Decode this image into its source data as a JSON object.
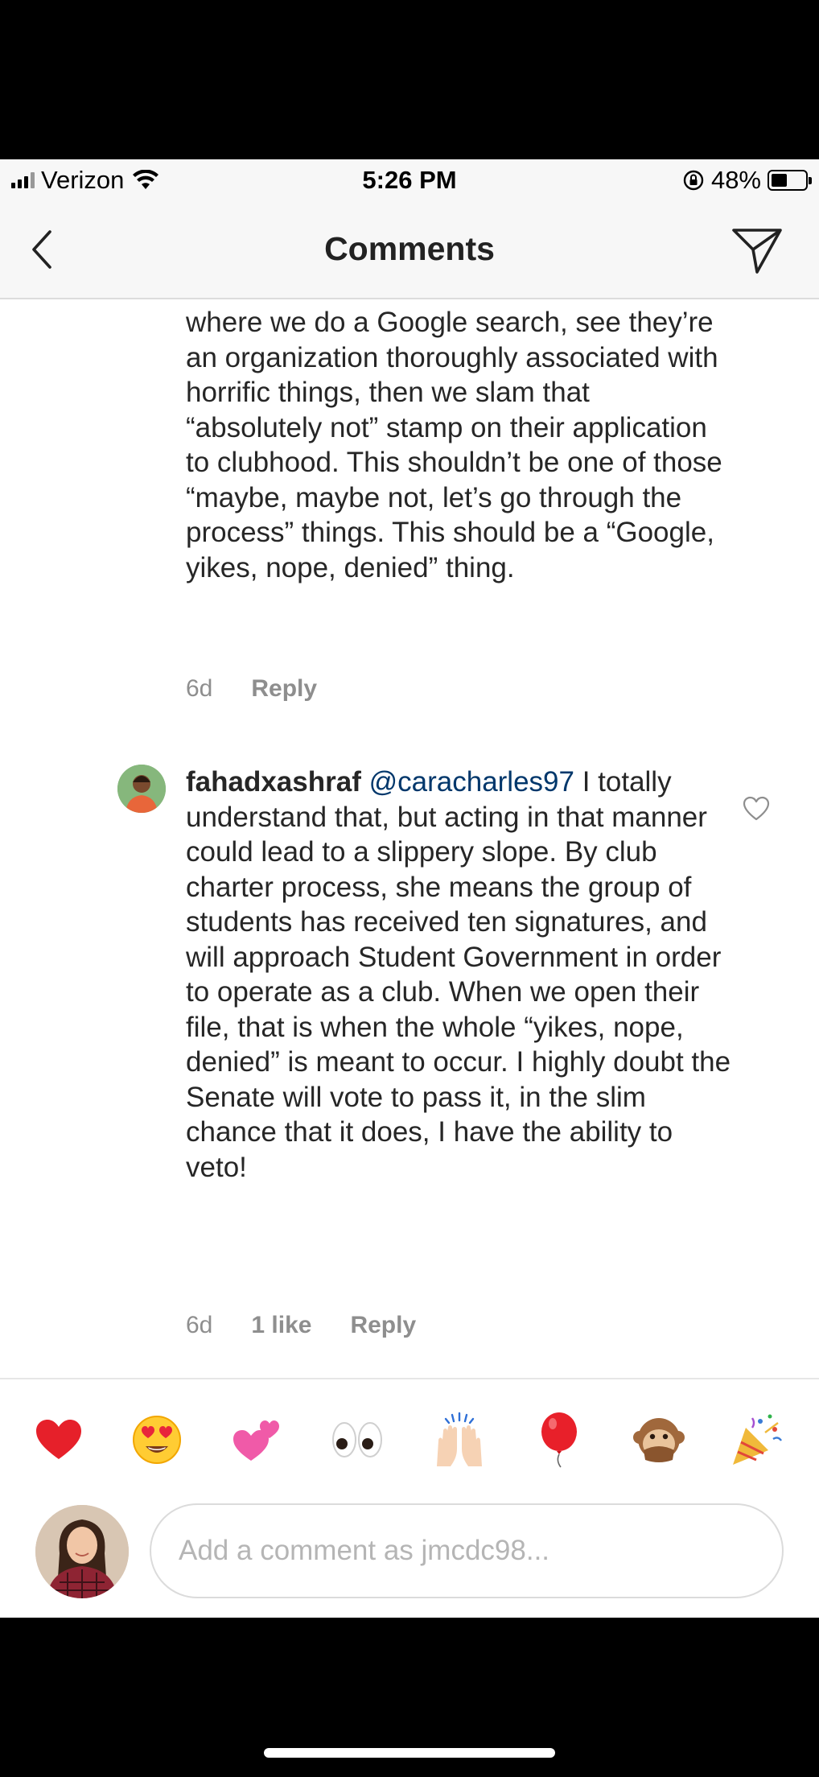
{
  "status_bar": {
    "carrier": "Verizon",
    "time": "5:26 PM",
    "battery_percent": "48%",
    "battery_level": 0.48,
    "icons": [
      "signal-icon",
      "wifi-icon",
      "orientation-lock-icon",
      "battery-icon"
    ]
  },
  "header": {
    "title": "Comments",
    "icons": [
      "back-chevron-icon",
      "direct-send-icon"
    ]
  },
  "comments": [
    {
      "text": "where we do a Google search, see they’re an organization thoroughly associated with horrific things, then we slam that “absolutely not” stamp on their application to clubhood. This shouldn’t be one of those “maybe, maybe not, let’s go through the process” things. This should be a “Google, yikes, nope, denied” thing.",
      "time": "6d",
      "reply_label": "Reply"
    },
    {
      "username": "fahadxashraf",
      "mention": "@caracharles97",
      "text": " I totally understand that, but acting in that manner could lead to a slippery slope. By club charter process, she means the group of students has received ten signatures, and will approach Student Government in order to operate as a club. When we open their file, that is when the whole “yikes, nope, denied” is meant to occur. I highly doubt the Senate will vote to pass it, in the slim chance that it does, I have the ability to veto!",
      "time": "6d",
      "likes": "1 like",
      "reply_label": "Reply"
    }
  ],
  "emoji_bar": [
    "red-heart",
    "heart-eyes",
    "revolving-hearts",
    "eyes",
    "raised-hands",
    "balloon",
    "speak-no-evil-monkey",
    "party-popper"
  ],
  "compose": {
    "placeholder": "Add a comment as jmcdc98..."
  },
  "colors": {
    "text": "#262626",
    "secondary": "#8e8e8e",
    "mention": "#00376b",
    "header_bg": "#f7f7f7"
  }
}
